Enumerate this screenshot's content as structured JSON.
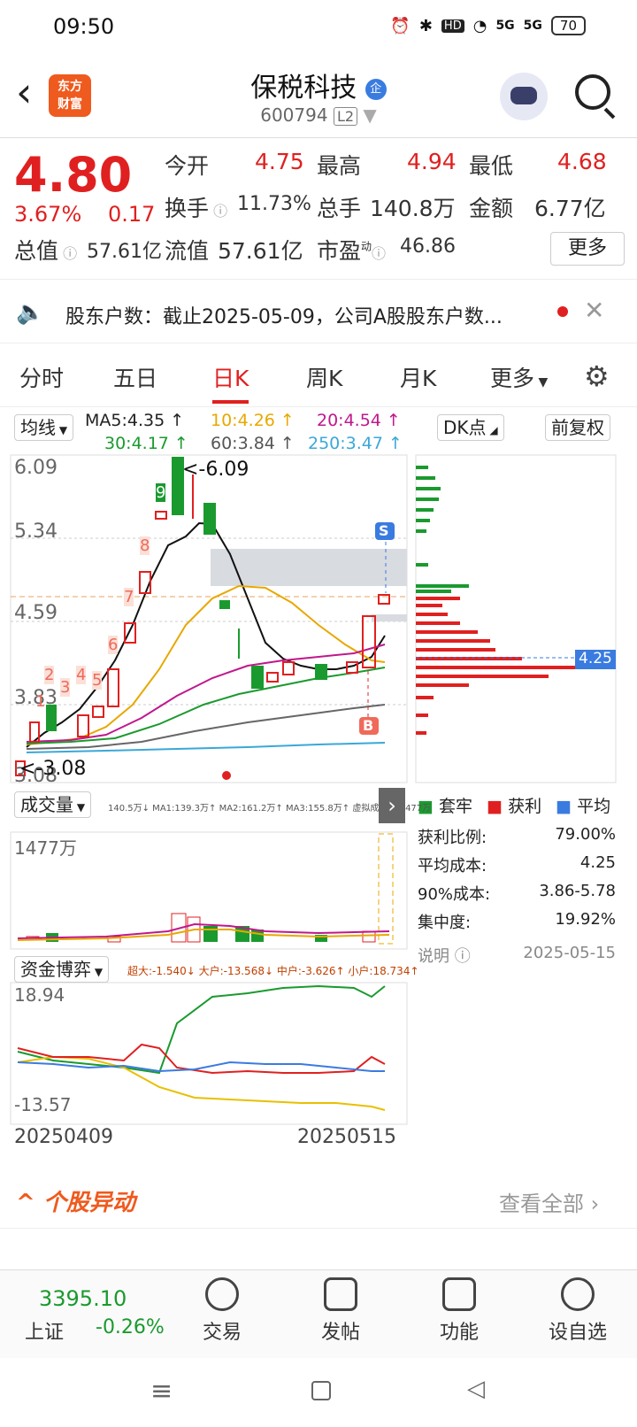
{
  "status_bar": {
    "time": "09:50",
    "icons": [
      "alarm-icon",
      "bluetooth-icon",
      "hd-icon",
      "wifi-icon",
      "5g-signal-icon",
      "5g-signal-icon"
    ],
    "hd": "HD",
    "net1": "5G",
    "net2": "5G",
    "battery": "70"
  },
  "header": {
    "back": "‹",
    "logo": "东方\n财富",
    "logo_l1": "东方",
    "logo_l2": "财富",
    "name": "保税科技",
    "qi": "企",
    "code": "600794",
    "level": "L2"
  },
  "quote": {
    "price": "4.80",
    "pct": "3.67%",
    "chg": "0.17",
    "open_label": "今开",
    "open": "4.75",
    "high_label": "最高",
    "high": "4.94",
    "low_label": "最低",
    "low": "4.68",
    "turnover_label": "换手",
    "turnover": "11.73%",
    "vol_label": "总手",
    "vol": "140.8万",
    "amount_label": "金额",
    "amount": "6.77亿",
    "mcap_label": "总值",
    "mcap": "57.61亿",
    "float_label": "流值",
    "float": "57.61亿",
    "pe_label": "市盈",
    "pe_sup": "动",
    "pe": "46.86",
    "more": "更多"
  },
  "notice": {
    "text": "股东户数：截止2025-05-09，公司A股股东户数..."
  },
  "tabs": [
    "分时",
    "五日",
    "日K",
    "周K",
    "月K",
    "更多"
  ],
  "active_tab": 2,
  "ma": {
    "label": "均线",
    "ma5": "MA5:4.35 ↑",
    "ma10": "10:4.26 ↑",
    "ma20": "20:4.54 ↑",
    "ma30": "30:4.17 ↑",
    "ma60": "60:3.84 ↑",
    "ma250": "250:3.47 ↑",
    "dk": "DK点",
    "fq": "前复权"
  },
  "kline": {
    "y_labels": [
      "6.09",
      "5.34",
      "4.59",
      "3.83",
      "3.08"
    ],
    "max_marker": "6.09",
    "min_marker": "3.08",
    "s_label": "S",
    "b_label": "B",
    "counts": [
      "1",
      "2",
      "3",
      "4",
      "5",
      "6",
      "7",
      "8",
      "9"
    ]
  },
  "chip": {
    "legend_tao": "套牢",
    "legend_huo": "获利",
    "legend_avg": "平均",
    "price_tag": "4.25",
    "rows": [
      {
        "k": "获利比例:",
        "v": "79.00%"
      },
      {
        "k": "平均成本:",
        "v": "4.25"
      },
      {
        "k": "90%成本:",
        "v": "3.86-5.78"
      },
      {
        "k": "集中度:",
        "v": "19.92%"
      }
    ],
    "note": "说明",
    "date": "2025-05-15"
  },
  "volume": {
    "label": "成交量",
    "stats": "140.5万↓ MA1:139.3万↑ MA2:161.2万↑ MA3:155.8万↑ 虚拟成交量:1477万",
    "max": "1477万"
  },
  "fund": {
    "label": "资金博弈",
    "stats": "超大:-1.540↓ 大户:-13.568↓ 中户:-3.626↑ 小户:18.734↑",
    "max": "18.94",
    "min": "-13.57"
  },
  "dates": {
    "start": "20250409",
    "end": "20250515"
  },
  "yidong": {
    "title": "个股异动",
    "more": "查看全部"
  },
  "bottom": {
    "index_value": "3395.10",
    "index_name": "上证",
    "index_pct": "-0.26%",
    "trade": "交易",
    "post": "发帖",
    "func": "功能",
    "fav": "设自选"
  },
  "colors": {
    "red": "#e02020",
    "green": "#1a9a2e",
    "accent": "#ef5a1e"
  }
}
